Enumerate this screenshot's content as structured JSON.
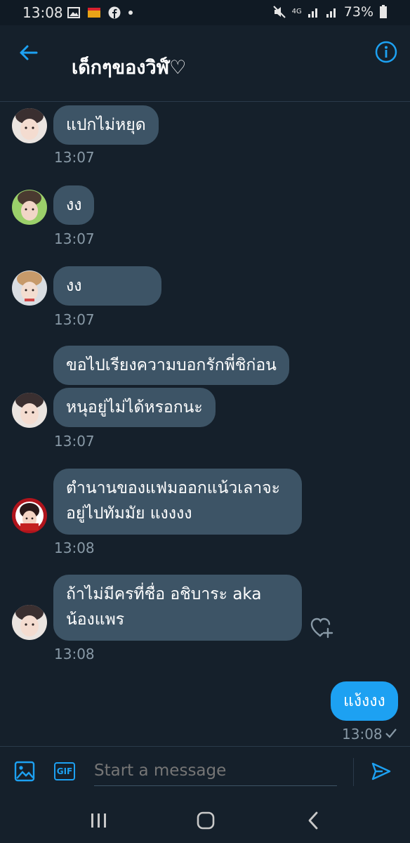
{
  "status_bar": {
    "time": "13:08",
    "network": "4G",
    "battery": "73%"
  },
  "header": {
    "title": "เด็กๆของวิฬ์♡",
    "back_icon": "arrow-left-icon",
    "info_icon": "info-icon"
  },
  "messages": [
    {
      "text": "แปกไม่หยุด",
      "time": "13:07"
    },
    {
      "text": "งง",
      "time": "13:07"
    },
    {
      "text": "งง",
      "time": "13:07"
    },
    {
      "text_1": "ขอไปเรียงความบอกรักพี่ชิก่อน",
      "text_2": "หนุอยู่ไม่ได้หรอกนะ",
      "time": "13:07"
    },
    {
      "line_1": "ตำนานของแฟมออกแน้วเลาจะ",
      "line_2": "อยู่ไปทัมมัย แงงงง",
      "time": "13:08"
    },
    {
      "line_1": "ถ้าไม่มีครที่ชื่อ อชิบาระ aka",
      "line_2": "น้องแพร",
      "time": "13:08"
    },
    {
      "text": "แง้งงง",
      "time": "13:08",
      "mine": true
    }
  ],
  "composer": {
    "placeholder": "Start a message",
    "gif_label": "GIF"
  },
  "colors": {
    "background": "#15202b",
    "bubble": "#3d5466",
    "accent": "#1da1f2"
  }
}
